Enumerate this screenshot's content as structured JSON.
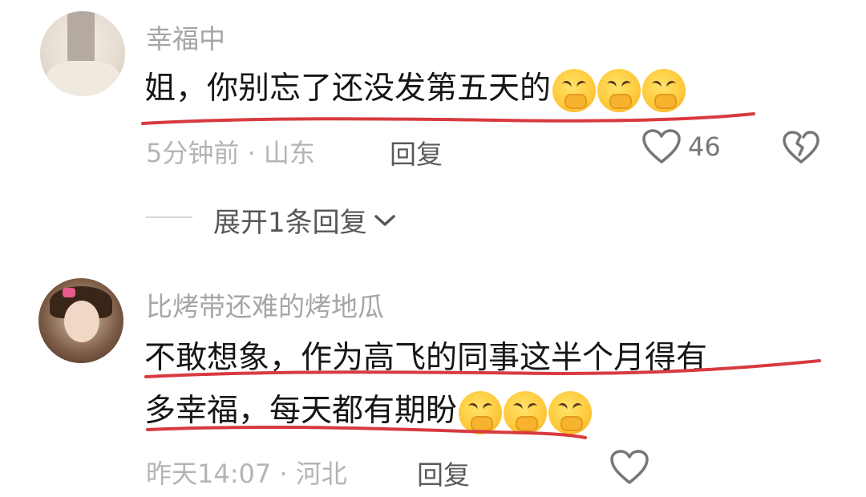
{
  "comments": [
    {
      "username": "幸福中",
      "text": "姐，你别忘了还没发第五天的",
      "time_location": "5分钟前 · 山东",
      "reply_label": "回复",
      "likes": "46",
      "expand_label": "展开1条回复"
    },
    {
      "username": "比烤带还难的烤地瓜",
      "text_line1": "不敢想象，作为高飞的同事这半个月得有",
      "text_line2": "多幸福，每天都有期盼",
      "time_location": "昨天14:07 · 河北",
      "reply_label": "回复"
    }
  ],
  "icons": {
    "like": "heart-outline-icon",
    "dislike": "broken-heart-icon",
    "expand": "chevron-down-icon",
    "emoji": "covering-mouth-laugh-emoji-icon"
  },
  "colors": {
    "underline": "#d83a3f",
    "username": "#a6a6a6",
    "meta": "#b4b4b4"
  }
}
